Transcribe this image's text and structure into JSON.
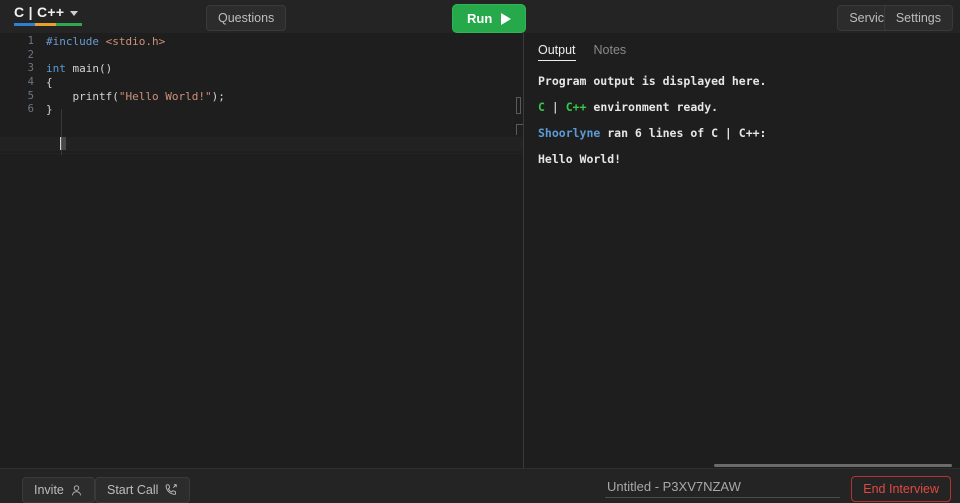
{
  "window": {
    "background": "#1e1e1e",
    "panel_background": "#242424"
  },
  "header": {
    "logo": {
      "label": "C | C++",
      "caret_icon": "chevron-down-icon",
      "underline_colors": [
        "#2f7fd6",
        "#e8a22a",
        "#2fa84f"
      ]
    },
    "questions_label": "Questions",
    "run_label": "Run",
    "run_icon": "play-icon",
    "run_color": "#26a94a",
    "service_label": "Service",
    "settings_label": "Settings"
  },
  "editor": {
    "language": "C | C++",
    "line_numbers": [
      "1",
      "2",
      "3",
      "4",
      "5",
      "6"
    ],
    "lines": [
      {
        "number": "1",
        "tokens": [
          {
            "text": "#include",
            "cls": "pre"
          },
          {
            "text": " ",
            "cls": "pun"
          },
          {
            "text": "<stdio.h>",
            "cls": "inc"
          }
        ]
      },
      {
        "number": "2",
        "tokens": []
      },
      {
        "number": "3",
        "tokens": [
          {
            "text": "int",
            "cls": "kw"
          },
          {
            "text": " main()",
            "cls": "fn"
          }
        ]
      },
      {
        "number": "4",
        "tokens": [
          {
            "text": "{",
            "cls": "pun"
          }
        ]
      },
      {
        "number": "5",
        "tokens": [
          {
            "text": "    printf(",
            "cls": "fn"
          },
          {
            "text": "\"Hello World!\"",
            "cls": "str"
          },
          {
            "text": ");",
            "cls": "pun"
          }
        ]
      },
      {
        "number": "6",
        "tokens": [
          {
            "text": "}",
            "cls": "pun"
          }
        ]
      }
    ],
    "plain_source": "#include <stdio.h>\n\nint main()\n{\n    printf(\"Hello World!\");\n}",
    "cursor_line": "6",
    "total_lines": "6"
  },
  "output_panel": {
    "tabs": [
      {
        "label": "Output",
        "active": true
      },
      {
        "label": "Notes",
        "active": false
      }
    ],
    "lines": [
      {
        "segments": [
          {
            "text": "Program output is displayed here.",
            "cls": "w"
          }
        ]
      },
      {
        "segments": [
          {
            "text": "C",
            "cls": "g"
          },
          {
            "text": " | ",
            "cls": "sep"
          },
          {
            "text": "C++",
            "cls": "g"
          },
          {
            "text": " environment ready.",
            "cls": "w"
          }
        ]
      },
      {
        "segments": [
          {
            "text": "Shoorlyne",
            "cls": "b"
          },
          {
            "text": " ran 6 lines of C | C++:",
            "cls": "w"
          }
        ]
      },
      {
        "segments": [
          {
            "text": "Hello World!",
            "cls": "w"
          }
        ]
      }
    ],
    "colors": {
      "green": "#35c84a",
      "blue": "#5b9bd5",
      "white": "#e6e6e6"
    }
  },
  "footer": {
    "invite_label": "Invite",
    "invite_icon": "person-icon",
    "start_call_label": "Start Call",
    "start_call_icon": "phone-outgoing-icon",
    "title_value": "Untitled - P3XV7NZAW",
    "title_placeholder": "Untitled",
    "end_interview_label": "End Interview",
    "end_interview_color": "#e04a42"
  }
}
